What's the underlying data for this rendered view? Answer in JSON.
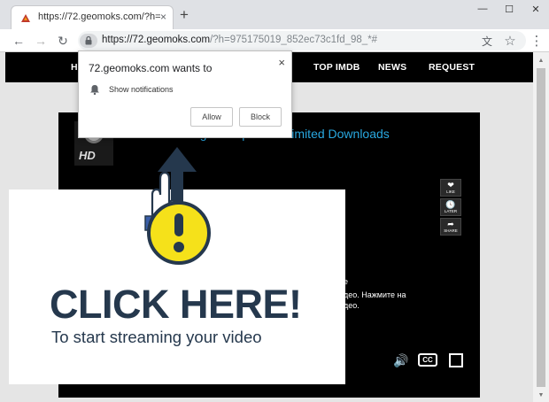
{
  "browser": {
    "tab": {
      "title": "https://72.geomoks.com/?h=975",
      "close": "×"
    },
    "new_tab": "+",
    "window_controls": {
      "minimize": "—",
      "maximize": "☐",
      "close": "✕"
    },
    "nav": {
      "back": "←",
      "forward": "→",
      "reload": "↻"
    },
    "address": {
      "host": "https://72.geomoks.com",
      "path": "/?h=975175019_852ec73c1fd_98_*#"
    },
    "toolbar_icons": {
      "translate": "文",
      "bookmark": "☆",
      "menu": "⋮"
    }
  },
  "site_nav": {
    "items": [
      "HO",
      "TOP IMDB",
      "NEWS",
      "REQUEST"
    ]
  },
  "player": {
    "logo_text": "HD",
    "title": "...ighest Speed Unlimited Downloads",
    "side_buttons": [
      {
        "icon": "❤",
        "label": "LIKE"
      },
      {
        "icon": "🕓",
        "label": "LATER"
      },
      {
        "icon": "➦",
        "label": "SHARE"
      }
    ],
    "body_lines": [
      "e",
      "део. Нажмите на",
      "део."
    ],
    "controls": {
      "volume": "🔊",
      "cc": "CC",
      "fullscreen": ""
    }
  },
  "notification": {
    "title": "72.geomoks.com wants to",
    "close": "×",
    "permission": "Show notifications",
    "allow_label": "Allow",
    "block_label": "Block"
  },
  "overlay_ad": {
    "headline": "CLICK HERE!",
    "subtext": "To start streaming your video",
    "accent_color": "#f5e11a",
    "ink_color": "#25384d"
  }
}
